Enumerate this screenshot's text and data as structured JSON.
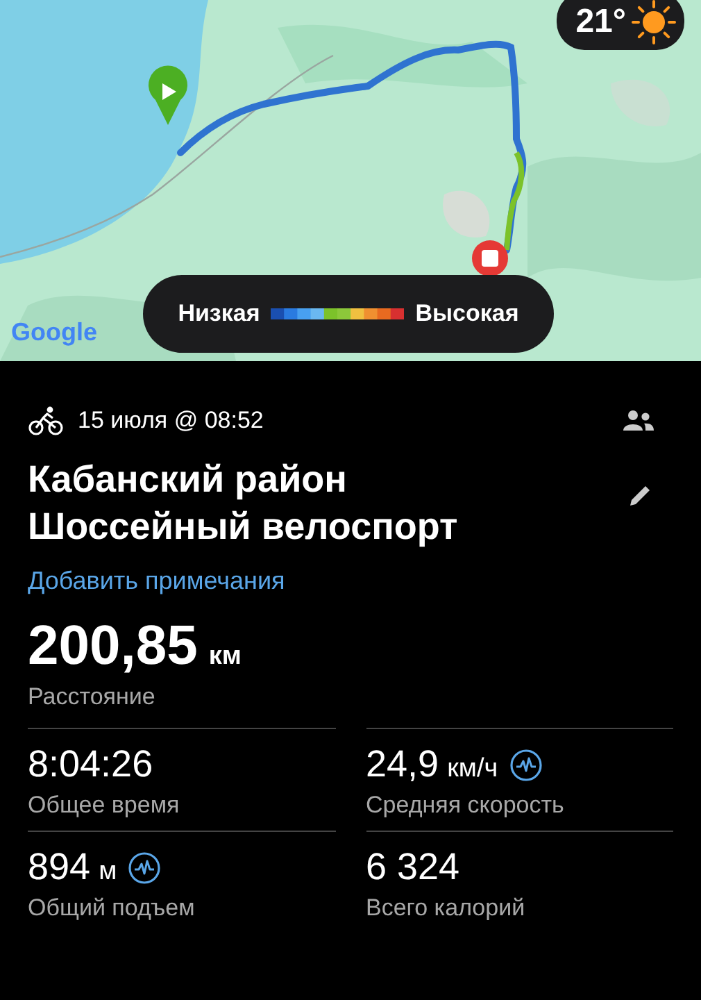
{
  "map": {
    "kind": "picture",
    "weather": {
      "temperature": "21°"
    },
    "legend": {
      "low": "Низкая",
      "high": "Высокая"
    },
    "attribution": "Google"
  },
  "activity": {
    "date": "15 июля @ 08:52",
    "title_lines": [
      "Кабанский район",
      "Шоссейный велоспорт"
    ],
    "notes_link": "Добавить примечания"
  },
  "distance": {
    "value": "200,85",
    "unit": "км",
    "label": "Расстояние"
  },
  "stats": [
    {
      "value": "8:04:26",
      "label": "Общее время",
      "has_chart": false
    },
    {
      "value": "24,9",
      "unit": "км/ч",
      "label": "Средняя скорость",
      "has_chart": true
    },
    {
      "value": "894",
      "unit": "м",
      "label": "Общий подъем",
      "has_chart": true
    },
    {
      "value": "6 324",
      "label": "Всего калорий",
      "has_chart": false
    }
  ]
}
